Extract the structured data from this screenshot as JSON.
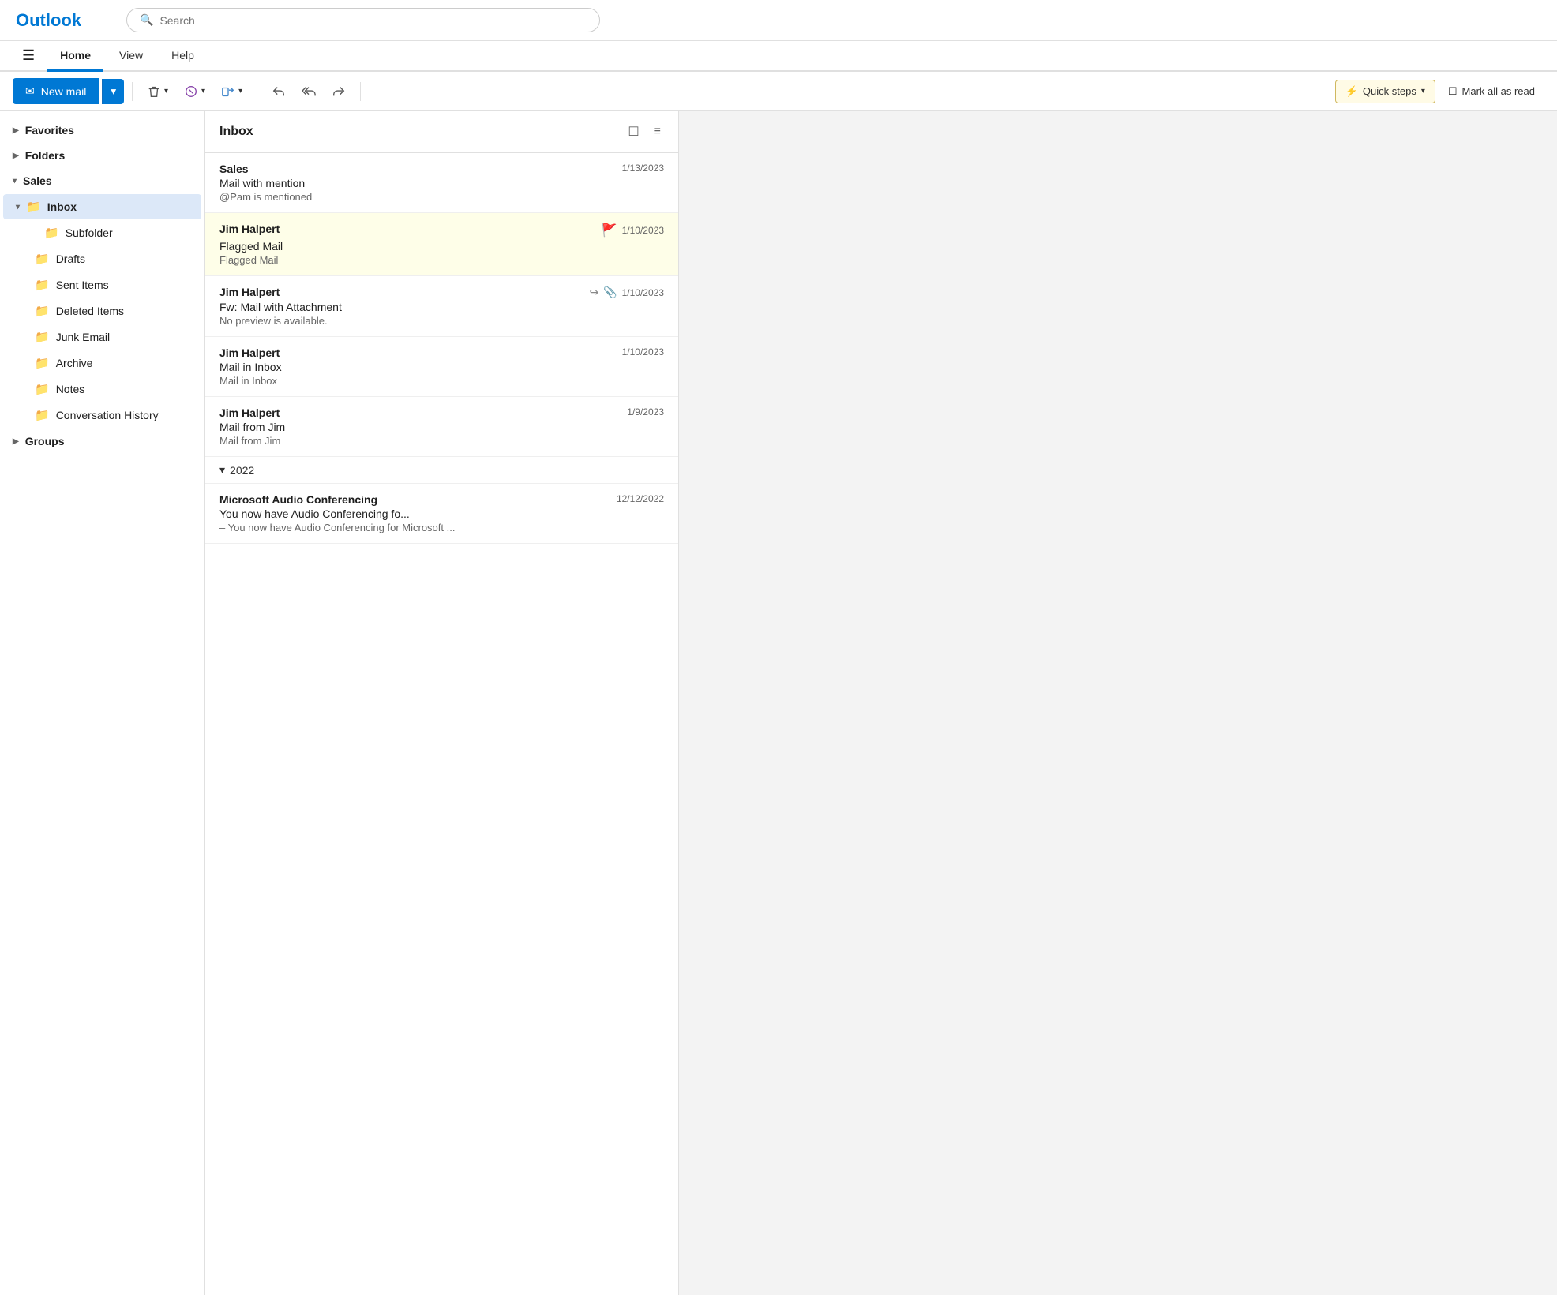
{
  "app": {
    "title": "Outlook"
  },
  "search": {
    "placeholder": "Search"
  },
  "navbar": {
    "hamburger": "☰",
    "items": [
      {
        "id": "home",
        "label": "Home",
        "active": true
      },
      {
        "id": "view",
        "label": "View",
        "active": false
      },
      {
        "id": "help",
        "label": "Help",
        "active": false
      }
    ]
  },
  "toolbar": {
    "new_mail_label": "New mail",
    "delete_label": "Delete",
    "junk_label": "Junk",
    "move_label": "Move",
    "reply_label": "Reply",
    "reply_all_label": "Reply all",
    "forward_label": "Forward",
    "quick_steps_label": "Quick steps",
    "mark_all_read_label": "Mark all as read"
  },
  "sidebar": {
    "favorites_label": "Favorites",
    "folders_label": "Folders",
    "sales_label": "Sales",
    "inbox_label": "Inbox",
    "subfolder_label": "Subfolder",
    "drafts_label": "Drafts",
    "sent_items_label": "Sent Items",
    "deleted_items_label": "Deleted Items",
    "junk_email_label": "Junk Email",
    "archive_label": "Archive",
    "notes_label": "Notes",
    "conversation_history_label": "Conversation History",
    "groups_label": "Groups"
  },
  "inbox": {
    "title": "Inbox",
    "emails": [
      {
        "sender": "Sales",
        "subject": "Mail with mention",
        "preview": "@Pam is mentioned",
        "date": "1/13/2023",
        "flagged": false,
        "forwarded": false,
        "attachment": false
      },
      {
        "sender": "Jim Halpert",
        "subject": "Flagged Mail",
        "preview": "Flagged Mail",
        "date": "1/10/2023",
        "flagged": true,
        "forwarded": false,
        "attachment": false
      },
      {
        "sender": "Jim Halpert",
        "subject": "Fw: Mail with Attachment",
        "preview": "No preview is available.",
        "date": "1/10/2023",
        "flagged": false,
        "forwarded": true,
        "attachment": true
      },
      {
        "sender": "Jim Halpert",
        "subject": "Mail in Inbox",
        "preview": "Mail in Inbox",
        "date": "1/10/2023",
        "flagged": false,
        "forwarded": false,
        "attachment": false
      },
      {
        "sender": "Jim Halpert",
        "subject": "Mail from Jim",
        "preview": "Mail from Jim",
        "date": "1/9/2023",
        "flagged": false,
        "forwarded": false,
        "attachment": false
      }
    ],
    "year_divider": "2022",
    "year_emails": [
      {
        "sender": "Microsoft Audio Conferencing",
        "subject": "You now have Audio Conferencing fo...",
        "preview": "– You now have Audio Conferencing for Microsoft ...",
        "date": "12/12/2022",
        "flagged": false,
        "forwarded": false,
        "attachment": false
      }
    ]
  }
}
